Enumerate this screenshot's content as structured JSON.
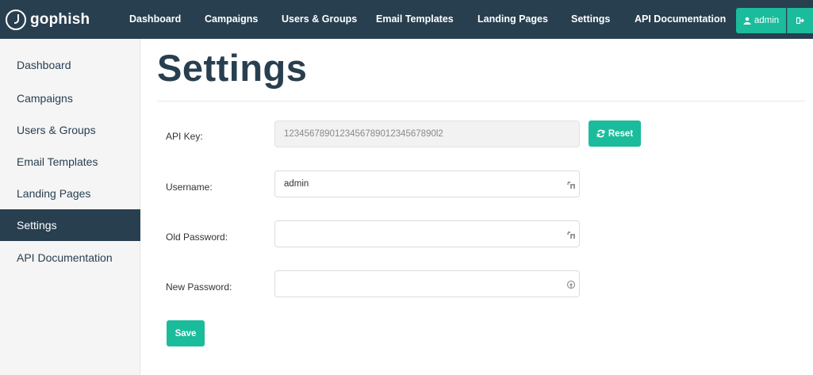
{
  "brand": {
    "name": "gophish",
    "icon": "gophish-logo-icon"
  },
  "navbar": {
    "links": [
      "Dashboard",
      "Campaigns",
      "Users & Groups",
      "Email Templates",
      "Landing Pages",
      "Settings",
      "API Documentation"
    ],
    "user_label": "admin",
    "user_icon": "user-icon",
    "logout_icon": "sign-out-icon"
  },
  "sidebar": {
    "items": [
      {
        "label": "Dashboard"
      },
      {
        "label": "Campaigns"
      },
      {
        "label": "Users & Groups"
      },
      {
        "label": "Email Templates"
      },
      {
        "label": "Landing Pages"
      },
      {
        "label": "Settings",
        "active": true
      },
      {
        "label": "API Documentation"
      }
    ]
  },
  "page": {
    "title": "Settings"
  },
  "form": {
    "api_key_label": "API Key:",
    "api_key_value": "123456789012345678901234567890l2",
    "reset_label": "Reset",
    "username_label": "Username:",
    "username_value": "admin",
    "old_password_label": "Old Password:",
    "old_password_value": "",
    "new_password_label": "New Password:",
    "new_password_value": "",
    "save_label": "Save"
  },
  "colors": {
    "nav_bg": "#283f50",
    "accent": "#1abc9c",
    "sidebar_bg": "#f5f5f5"
  }
}
